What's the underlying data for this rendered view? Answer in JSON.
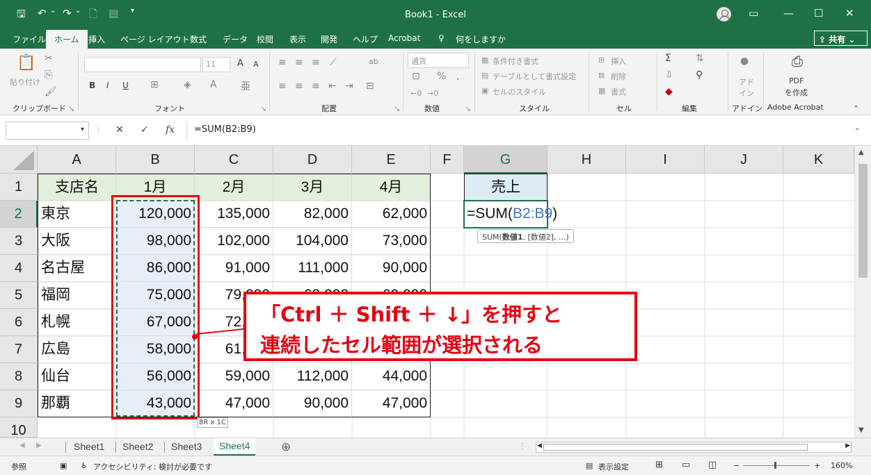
{
  "titlebar": {
    "title": "Book1  -  Excel",
    "save": "🖫",
    "undo": "↶",
    "undo_dd": "⌄",
    "redo": "↷",
    "redo_dd": "⌄",
    "qat_more": "▾",
    "restore": "▭",
    "minimize": "—",
    "maximize": "☐",
    "close": "✕"
  },
  "tabs": [
    "ファイル",
    "ホーム",
    "挿入",
    "ページ レイアウト",
    "数式",
    "データ",
    "校閲",
    "表示",
    "開発",
    "ヘルプ",
    "Acrobat"
  ],
  "tell_me": "何をしますか",
  "share_label": "共有",
  "ribbon": {
    "clipboard": "クリップボード",
    "font": "フォント",
    "alignment": "配置",
    "number": "数値",
    "styles": "スタイル",
    "cells": "セル",
    "editing": "編集",
    "addins": "アドイン",
    "adobe": "Adobe Acrobat",
    "paste": "貼り付け",
    "font_size": "11",
    "number_format": "通貨",
    "cond_format": "条件付き書式",
    "table_format": "テーブルとして書式設定",
    "cell_style": "セルのスタイル",
    "insert": "挿入",
    "delete": "削除",
    "format": "書式",
    "addin_btn": "アド イン",
    "pdf_create_1": "PDF",
    "pdf_create_2": "を作成",
    "bold": "B",
    "italic": "I",
    "underline": "U",
    "font_up": "A",
    "font_down": "A"
  },
  "formula_bar": {
    "name_box": "",
    "cancel": "✕",
    "enter": "✓",
    "fx": "fx",
    "formula": "=SUM(B2:B9)"
  },
  "columns": [
    "A",
    "B",
    "C",
    "D",
    "E",
    "F",
    "G",
    "H",
    "I",
    "J",
    "K"
  ],
  "rows": [
    "1",
    "2",
    "3",
    "4",
    "5",
    "6",
    "7",
    "8",
    "9",
    "10"
  ],
  "table": {
    "headers": [
      "支店名",
      "1月",
      "2月",
      "3月",
      "4月"
    ],
    "data": [
      [
        "東京",
        "120,000",
        "135,000",
        "82,000",
        "62,000"
      ],
      [
        "大阪",
        "98,000",
        "102,000",
        "104,000",
        "73,000"
      ],
      [
        "名古屋",
        "86,000",
        "91,000",
        "111,000",
        "90,000"
      ],
      [
        "福岡",
        "75,000",
        "79,000",
        "63,000",
        "60,000"
      ],
      [
        "札幌",
        "67,000",
        "72,000",
        "",
        ""
      ],
      [
        "広島",
        "58,000",
        "61,000",
        "",
        ""
      ],
      [
        "仙台",
        "56,000",
        "59,000",
        "112,000",
        "44,000"
      ],
      [
        "那覇",
        "43,000",
        "47,000",
        "90,000",
        "47,000"
      ]
    ]
  },
  "g1_label": "売上",
  "g2_formula": {
    "prefix": "=SUM(",
    "ref": "B2:B9",
    "suffix": ")"
  },
  "formula_tooltip": {
    "prefix": "SUM(",
    "bold": "数値1",
    "suffix": ", [数値2], ...)"
  },
  "selection_size": "8R x 1C",
  "callout": {
    "line1": "「Ctrl ＋ Shift ＋ ↓」を押すと",
    "line2": "連続したセル範囲が選択される"
  },
  "sheets": [
    "Sheet1",
    "Sheet2",
    "Sheet3",
    "Sheet4"
  ],
  "active_sheet": "Sheet4",
  "add_sheet": "⊕",
  "status": {
    "mode": "参照",
    "accessibility": "アクセシビリティ: 検討が必要です",
    "display_settings": "表示設定",
    "zoom": "160%",
    "zoom_minus": "−",
    "zoom_plus": "+"
  },
  "colors": {
    "excel_green": "#1e7145",
    "callout_red": "#e60012",
    "ref_blue": "#4472c4"
  }
}
